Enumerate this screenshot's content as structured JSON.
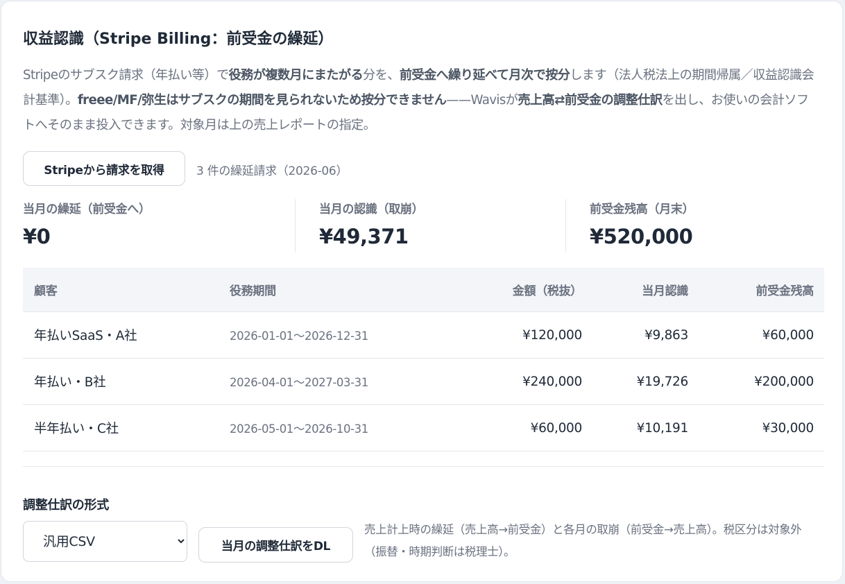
{
  "panel": {
    "title": "収益認識（Stripe Billing：前受金の繰延）",
    "description": {
      "t1": "Stripeのサブスク請求（年払い等）で",
      "b1": "役務が複数月にまたがる",
      "t2": "分を、",
      "b2": "前受金へ繰り延べて月次で按分",
      "t3": "します（法人税法上の期間帰属／収益認識会計基準）。",
      "b3": "freee/MF/弥生はサブスクの期間を見られないため按分できません",
      "t4": "——Wavisが",
      "b4": "売上高⇄前受金の調整仕訳",
      "t5": "を出し、お使いの会計ソフトへそのまま投入できます。対象月は上の売上レポートの指定。"
    }
  },
  "fetch": {
    "button_label": "Stripeから請求を取得",
    "status": "3 件の繰延請求（2026-06）"
  },
  "kpis": {
    "deferral": {
      "label": "当月の繰延（前受金へ）",
      "value": "¥0"
    },
    "recognition": {
      "label": "当月の認識（取崩）",
      "value": "¥49,371"
    },
    "balance": {
      "label": "前受金残高（月末）",
      "value": "¥520,000"
    }
  },
  "table": {
    "headers": {
      "customer": "顧客",
      "period": "役務期間",
      "amount": "金額（税抜）",
      "recognized": "当月認識",
      "balance": "前受金残高"
    },
    "rows": [
      {
        "customer": "年払いSaaS・A社",
        "period": "2026-01-01〜2026-12-31",
        "amount": "¥120,000",
        "recognized": "¥9,863",
        "balance": "¥60,000"
      },
      {
        "customer": "年払い・B社",
        "period": "2026-04-01〜2027-03-31",
        "amount": "¥240,000",
        "recognized": "¥19,726",
        "balance": "¥200,000"
      },
      {
        "customer": "半年払い・C社",
        "period": "2026-05-01〜2026-10-31",
        "amount": "¥60,000",
        "recognized": "¥10,191",
        "balance": "¥30,000"
      }
    ]
  },
  "export": {
    "format_label": "調整仕訳の形式",
    "format_selected": "汎用CSV",
    "download_label": "当月の調整仕訳をDL",
    "note": "売上計上時の繰延（売上高→前受金）と各月の取崩（前受金→売上高）。税区分は対象外（振替・時期判断は税理士）。"
  }
}
